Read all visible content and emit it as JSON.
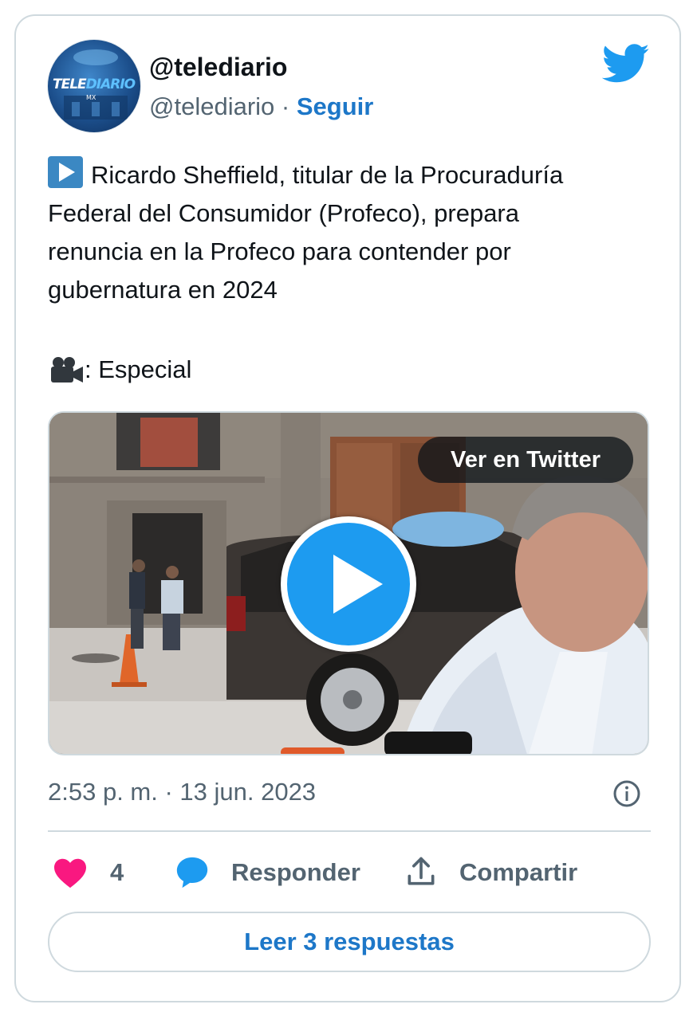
{
  "tweet": {
    "display_name": "@telediario",
    "handle": "@telediario",
    "separator": " · ",
    "follow_label": "Seguir",
    "avatar_logo": {
      "part1": "TELE",
      "part2": "DIARIO",
      "sub": "MX"
    },
    "text_lines": [
      "Ricardo Sheffield, titular de la Procuraduría",
      "Federal del Consumidor (Profeco), prepara",
      "renuncia en la Profeco para contender por",
      "gubernatura en 2024"
    ],
    "text_leading_icon": "play-button-emoji",
    "credit_icon": "movie-camera-emoji",
    "credit_text": ": Especial",
    "media": {
      "overlay_label": "Ver en Twitter",
      "play_icon": "play-icon"
    },
    "timestamp": "2:53 p. m. · 13 jun. 2023",
    "actions": {
      "like_count": "4",
      "reply_label": "Responder",
      "share_label": "Compartir"
    },
    "read_replies_label": "Leer 3 respuestas"
  },
  "colors": {
    "twitter_blue": "#1d9bf0",
    "link_blue": "#1d77c8",
    "heart_pink": "#f91880",
    "muted_text": "#536471",
    "border": "#cfd9de"
  }
}
